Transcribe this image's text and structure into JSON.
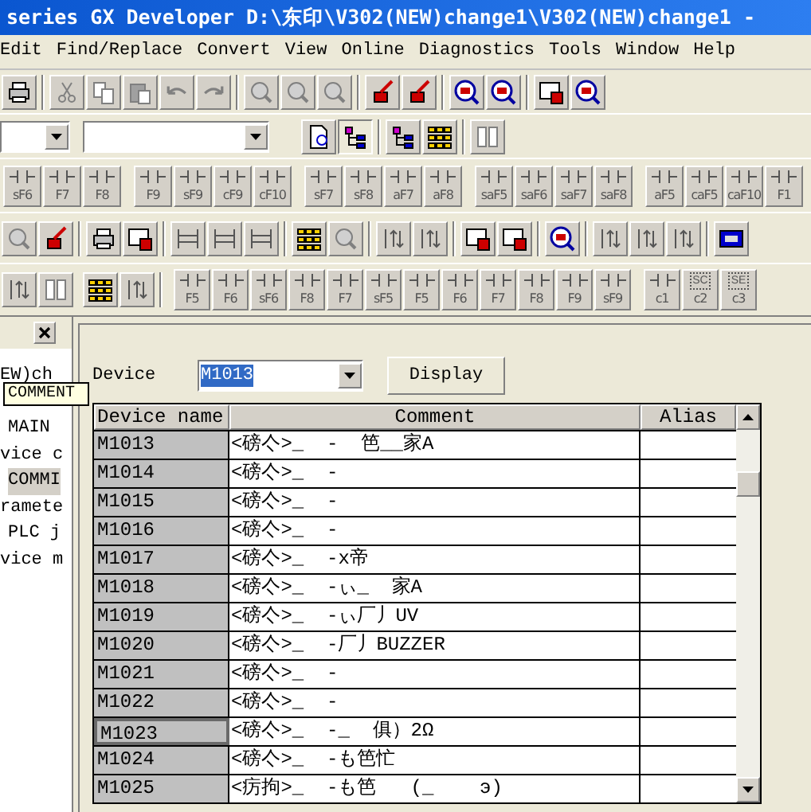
{
  "window": {
    "title": "series GX Developer D:\\东印\\V302(NEW)change1\\V302(NEW)change1 -"
  },
  "menu": [
    "Edit",
    "Find/Replace",
    "Convert",
    "View",
    "Online",
    "Diagnostics",
    "Tools",
    "Window",
    "Help"
  ],
  "ladder_toolbar": [
    {
      "label": "sF6"
    },
    {
      "label": "F7"
    },
    {
      "label": "F8"
    },
    {
      "label": "F9"
    },
    {
      "label": "sF9"
    },
    {
      "label": "cF9"
    },
    {
      "label": "cF10"
    },
    {
      "label": "sF7"
    },
    {
      "label": "sF8"
    },
    {
      "label": "aF7"
    },
    {
      "label": "aF8"
    },
    {
      "label": "saF5"
    },
    {
      "label": "saF6"
    },
    {
      "label": "saF7"
    },
    {
      "label": "saF8"
    },
    {
      "label": "aF5"
    },
    {
      "label": "caF5"
    },
    {
      "label": "caF10"
    },
    {
      "label": "F1"
    }
  ],
  "sfc_toolbar": [
    {
      "label": "F5"
    },
    {
      "label": "F6"
    },
    {
      "label": "sF6"
    },
    {
      "label": "F8"
    },
    {
      "label": "F7"
    },
    {
      "label": "sF5"
    },
    {
      "label": "F5"
    },
    {
      "label": "F6"
    },
    {
      "label": "F7"
    },
    {
      "label": "F8"
    },
    {
      "label": "F9"
    },
    {
      "label": "sF9"
    },
    {
      "label": "c1"
    },
    {
      "label": "c2",
      "top": "SC"
    },
    {
      "label": "c3",
      "top": "SE"
    }
  ],
  "project_tree": {
    "items": [
      {
        "label": "EW)ch",
        "selected": false,
        "children": [
          {
            "label": "MAIN",
            "selected": false
          }
        ]
      },
      {
        "label": "vice c",
        "selected": false,
        "children": [
          {
            "label": "COMMI",
            "selected": true
          }
        ]
      },
      {
        "label": "ramete",
        "selected": false,
        "children": [
          {
            "label": "PLC j",
            "selected": false
          }
        ]
      },
      {
        "label": "vice m",
        "selected": false
      }
    ]
  },
  "tooltip": "COMMENT",
  "device": {
    "label": "Device",
    "value": "M1013",
    "button": "Display"
  },
  "table": {
    "columns": [
      "Device name",
      "Comment",
      "Alias"
    ],
    "rows": [
      {
        "device": "M1013",
        "comment": "<磅亽>_  -  笆__家A",
        "focused": false
      },
      {
        "device": "M1014",
        "comment": "<磅亽>_  -",
        "focused": false
      },
      {
        "device": "M1015",
        "comment": "<磅亽>_  -",
        "focused": false
      },
      {
        "device": "M1016",
        "comment": "<磅亽>_  -",
        "focused": false
      },
      {
        "device": "M1017",
        "comment": "<磅亽>_  -х帝",
        "focused": false
      },
      {
        "device": "M1018",
        "comment": "<磅亽>_  -ぃ_  家A",
        "focused": false
      },
      {
        "device": "M1019",
        "comment": "<磅亽>_  -ぃ厂丿UV",
        "focused": false
      },
      {
        "device": "M1020",
        "comment": "<磅亽>_  -厂丿BUZZER",
        "focused": false
      },
      {
        "device": "M1021",
        "comment": "<磅亽>_  -",
        "focused": false
      },
      {
        "device": "M1022",
        "comment": "<磅亽>_  -",
        "focused": false
      },
      {
        "device": "M1023",
        "comment": "<磅亽>_  -_  俱）2Ω",
        "focused": true
      },
      {
        "device": "M1024",
        "comment": "<磅亽>_  -も笆忙",
        "focused": false
      },
      {
        "device": "M1025",
        "comment": "<疠拘>_  -も笆   (_    э)",
        "focused": false
      }
    ]
  }
}
